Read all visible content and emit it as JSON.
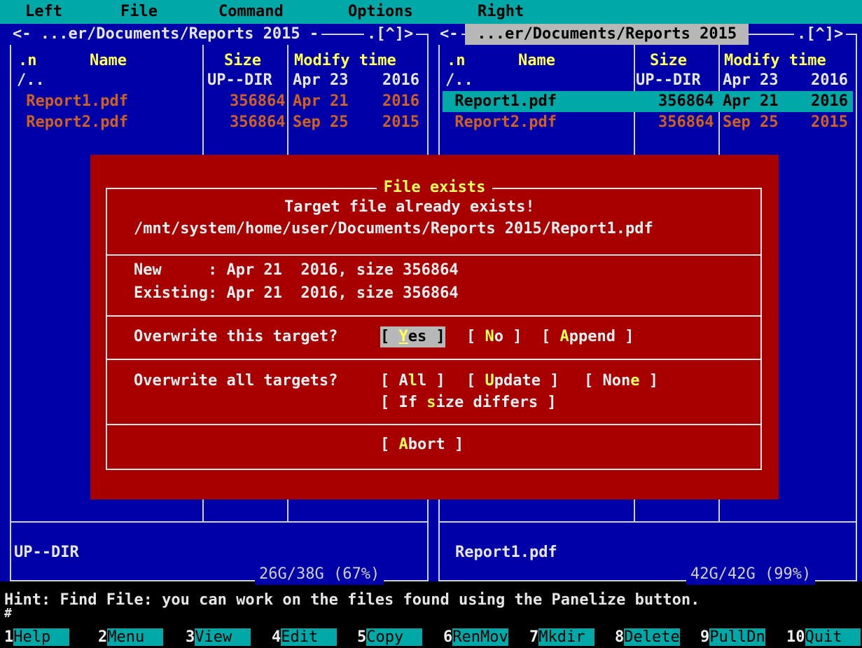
{
  "menubar": {
    "left": "Left",
    "file": "File",
    "command": "Command",
    "options": "Options",
    "right": "Right"
  },
  "left_panel": {
    "path": "<- ...er/Documents/Reports 2015 -",
    "path_right": ".[^]>",
    "columns": {
      "n": ".n",
      "name": "Name",
      "size": "Size",
      "mtime": "Modify time"
    },
    "rows": [
      {
        "name": "/..",
        "size": "UP--DIR",
        "date": "Apr 23",
        "year": "2016"
      },
      {
        "name": " Report1.pdf",
        "size": "356864",
        "date": "Apr 21",
        "year": "2016"
      },
      {
        "name": " Report2.pdf",
        "size": "356864",
        "date": "Sep 25",
        "year": "2015"
      }
    ],
    "status": "UP--DIR",
    "free": "26G/38G (67%)"
  },
  "right_panel": {
    "path_arrow": "<-",
    "path": " ...er/Documents/Reports 2015 ",
    "path_right": ".[^]>",
    "columns": {
      "n": ".n",
      "name": "Name",
      "size": "Size",
      "mtime": "Modify time"
    },
    "rows": [
      {
        "name": "/..",
        "size": "UP--DIR",
        "date": "Apr 23",
        "year": "2016"
      },
      {
        "name": " Report1.pdf",
        "size": "356864",
        "date": "Apr 21",
        "year": "2016"
      },
      {
        "name": " Report2.pdf",
        "size": "356864",
        "date": "Sep 25",
        "year": "2015"
      }
    ],
    "status": "Report1.pdf",
    "free": "42G/42G (99%)"
  },
  "dialog": {
    "title": "File exists",
    "message": "Target file already exists!",
    "path": "/mnt/system/home/user/Documents/Reports 2015/Report1.pdf",
    "new_line": "New     : Apr 21  2016, size 356864",
    "existing_line": "Existing: Apr 21  2016, size 356864",
    "overwrite_this": "Overwrite this target?",
    "overwrite_all": "Overwrite all targets?",
    "buttons": {
      "yes": {
        "pre": "[ ",
        "hot": "Y",
        "post": "es ]"
      },
      "no": {
        "pre": "[ ",
        "hot": "N",
        "post": "o ]"
      },
      "append": {
        "pre": "[ ",
        "hot": "A",
        "post": "ppend ]"
      },
      "all": {
        "pre": "[ A",
        "hot": "l",
        "post": "l ]"
      },
      "update": {
        "pre": "[ ",
        "hot": "U",
        "post": "pdate ]"
      },
      "none": {
        "pre": "[ Non",
        "hot": "e",
        "post": " ]"
      },
      "size_differs": {
        "pre": "[ If ",
        "hot": "s",
        "post": "ize differs ]"
      },
      "abort": {
        "pre": "[ ",
        "hot": "A",
        "post": "bort ]"
      }
    }
  },
  "hint": "Hint: Find File: you can work on the files found using the Panelize button.",
  "command_prompt": "#",
  "fkeys": [
    {
      "num": "1",
      "label": "Help  "
    },
    {
      "num": "2",
      "label": "Menu  "
    },
    {
      "num": "3",
      "label": "View  "
    },
    {
      "num": "4",
      "label": "Edit  "
    },
    {
      "num": "5",
      "label": "Copy  "
    },
    {
      "num": "6",
      "label": "RenMov"
    },
    {
      "num": "7",
      "label": "Mkdir "
    },
    {
      "num": "8",
      "label": "Delete"
    },
    {
      "num": "9",
      "label": "PullDn"
    },
    {
      "num": "10",
      "label": "Quit  "
    }
  ],
  "colors": {
    "panel_bg": "#0000a8",
    "menubar_bg": "#00a8a8",
    "dialog_bg": "#a80000",
    "hotkey": "#ffff54",
    "file_color": "#d06020"
  }
}
